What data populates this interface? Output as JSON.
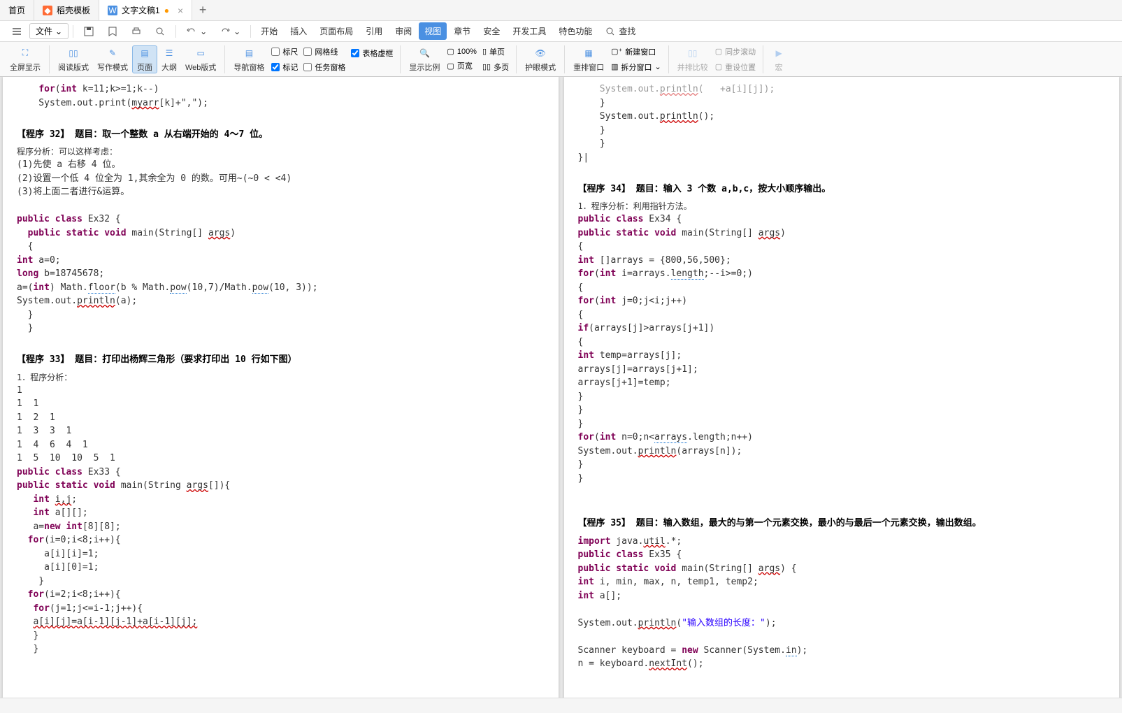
{
  "tabs": [
    {
      "label": "首页",
      "icon": ""
    },
    {
      "label": "稻壳模板",
      "icon": "orange"
    },
    {
      "label": "文字文稿1",
      "icon": "blue",
      "modified": true
    }
  ],
  "file_menu": "文件",
  "menu_items": [
    "开始",
    "插入",
    "页面布局",
    "引用",
    "审阅",
    "视图",
    "章节",
    "安全",
    "开发工具",
    "特色功能"
  ],
  "menu_active_index": 5,
  "search": "查找",
  "toolbar": {
    "fullscreen": "全屏显示",
    "read_layout": "阅读版式",
    "write_mode": "写作模式",
    "page": "页面",
    "outline": "大纲",
    "web": "Web版式",
    "ruler": "标尺",
    "gridlines": "网格线",
    "markup": "标记",
    "table_gridlines": "表格虚框",
    "task_pane": "任务窗格",
    "nav_pane": "导航窗格",
    "zoom_ratio": "显示比例",
    "zoom_100": "100%",
    "single_page": "单页",
    "multi_page": "多页",
    "page_width": "页宽",
    "eye_protect": "护眼模式",
    "arrange_win": "重排窗口",
    "new_win": "新建窗口",
    "split_win": "拆分窗口",
    "side_by_side": "并排比较",
    "sync_scroll": "同步滚动",
    "reset_pos": "重设位置",
    "macro": "宏"
  },
  "page_left": {
    "top_code": [
      "    for(int k=11;k>=1;k--)",
      "    System.out.print(myarr[k]+\",\");"
    ],
    "sec32_title": "【程序 32】    题目：取一个整数 a 从右端开始的 4～7 位。",
    "sec32_analysis": "程序分析：可以这样考虑：",
    "sec32_steps": [
      "(1)先使 a 右移 4 位。",
      "(2)设置一个低 4 位全为 1,其余全为 0 的数。可用~(~0 < <4)",
      "(3)将上面二者进行&运算。"
    ],
    "sec32_code": [
      {
        "t": "public class Ex32 {"
      },
      {
        "t": "  public static void main(String[] args)"
      },
      {
        "t": "  {"
      },
      {
        "t": "int a=0;"
      },
      {
        "t": "long b=18745678;"
      },
      {
        "t": "a=(int) Math.floor(b % Math.pow(10,7)/Math.pow(10, 3));"
      },
      {
        "t": "System.out.println(a);"
      },
      {
        "t": "  }"
      },
      {
        "t": "  }"
      }
    ],
    "sec33_title": "【程序 33】    题目：打印出杨辉三角形（要求打印出 10 行如下图）",
    "sec33_analysis": "1．程序分析：",
    "triangle": [
      "1",
      "1  1",
      "1  2  1",
      "1  3  3  1",
      "1  4  6  4  1",
      "1  5  10  10  5  1"
    ],
    "sec33_code": [
      "public class Ex33 {",
      "public static void main(String args[]){",
      "   int i,j;",
      "   int a[][];",
      "   a=new int[8][8];",
      "  for(i=0;i<8;i++){",
      "     a[i][i]=1;",
      "     a[i][0]=1;",
      "    }",
      "  for(i=2;i<8;i++){",
      "   for(j=1;j<=i-1;j++){",
      "   a[i][j]=a[i-1][j-1]+a[i-1][j];",
      "   }",
      "   }"
    ]
  },
  "page_right": {
    "top_code": [
      "    System.out.println(   +a[i][j]);",
      "    }",
      "    System.out.println();",
      "    }",
      "    }",
      "}"
    ],
    "sec34_title": "【程序 34】    题目：输入 3 个数 a,b,c，按大小顺序输出。",
    "sec34_analysis": "1．程序分析：利用指针方法。",
    "sec34_code": [
      "public class Ex34 {",
      "public static void main(String[] args)",
      "{",
      "int []arrays = {800,56,500};",
      "for(int i=arrays.length;--i>=0;)",
      "{",
      "for(int j=0;j<i;j++)",
      "{",
      "if(arrays[j]>arrays[j+1])",
      "{",
      "int temp=arrays[j];",
      "arrays[j]=arrays[j+1];",
      "arrays[j+1]=temp;",
      "}",
      "}",
      "}",
      "for(int n=0;n<arrays.length;n++)",
      "System.out.println(arrays[n]);",
      "}",
      "}"
    ],
    "sec35_title": "【程序 35】    题目：输入数组，最大的与第一个元素交换，最小的与最后一个元素交换，输出数组。",
    "sec35_code": [
      "import java.util.*;",
      "public class Ex35 {",
      "public static void main(String[] args) {",
      "int i, min, max, n, temp1, temp2;",
      "int a[];",
      "",
      "System.out.println(\"输入数组的长度：\");",
      "",
      "Scanner keyboard = new Scanner(System.in);",
      "n = keyboard.nextInt();"
    ]
  }
}
